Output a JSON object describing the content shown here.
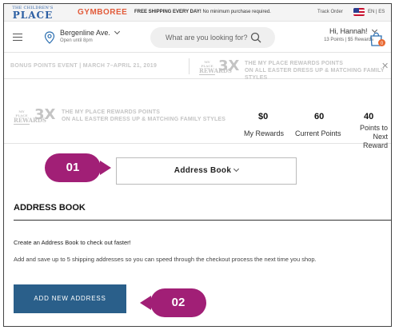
{
  "topbar": {
    "logo_place_small": "THE CHILDREN'S",
    "logo_place_big": "PLACE",
    "logo_gymboree": "GYMBOREE",
    "promo_bold": "FREE SHIPPING EVERY DAY!",
    "promo_rest": " No minimum purchase required.",
    "track_order": "Track Order",
    "language": "EN | ES"
  },
  "header": {
    "store_name": "Bergenline Ave.",
    "store_hours": "Open until 8pm",
    "search_placeholder": "What are you looking for?",
    "greeting": "Hi, Hannah!",
    "points_summary": "13 Points  |  $5 Rewards",
    "bag_count": "0"
  },
  "banner": {
    "event": "BONUS POINTS EVENT  |  MARCH 7–APRIL 21, 2019",
    "mini_logo_top": "MY PLACE",
    "mini_logo_bottom": "REWARDS",
    "multiplier": "3X",
    "line1": "THE MY PLACE REWARDS POINTS",
    "line2": "ON ALL EASTER DRESS UP & MATCHING FAMILY STYLES"
  },
  "rewards": {
    "mini_logo_top": "MY PLACE",
    "mini_logo_bottom": "REWARDS",
    "multiplier": "3X",
    "line1": "THE MY PLACE REWARDS POINTS",
    "line2": "ON ALL EASTER DRESS UP & MATCHING FAMILY STYLES",
    "stats": [
      {
        "value": "$0",
        "label": "My Rewards"
      },
      {
        "value": "60",
        "label": "Current Points"
      },
      {
        "value": "40",
        "label_line1": "Points to",
        "label_line2": "Next Reward"
      }
    ]
  },
  "callouts": {
    "badge1": "01",
    "badge2": "02",
    "color": "#a11f76"
  },
  "address": {
    "dropdown_label": "Address Book",
    "section_title": "ADDRESS BOOK",
    "intro": "Create an Address Book to check out faster!",
    "description": "Add and save up to 5 shipping addresses so you can speed through the checkout process the next time you shop.",
    "add_button": "ADD NEW ADDRESS",
    "button_color": "#2a5f8a"
  }
}
